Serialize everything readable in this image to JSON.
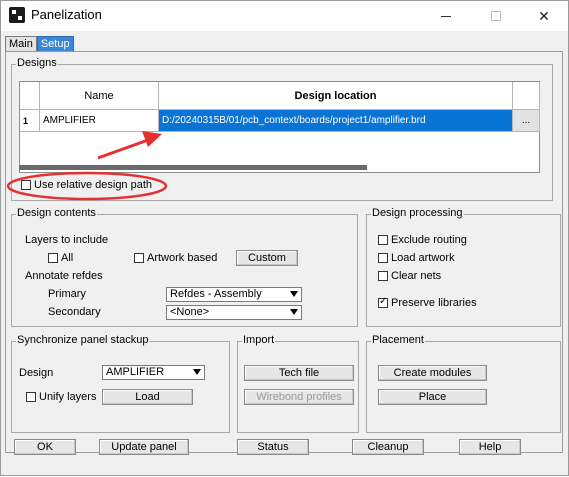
{
  "window": {
    "title": "Panelization"
  },
  "tabs": [
    {
      "label": "Main"
    },
    {
      "label": "Setup"
    }
  ],
  "designs": {
    "title": "Designs",
    "headers": {
      "index": "",
      "name": "Name",
      "location": "Design location",
      "extra": ""
    },
    "rows": [
      {
        "index": "1",
        "name": "AMPLIFIER",
        "location": "D:/20240315B/01/pcb_context/boards/project1/amplifier.brd",
        "extra": "..."
      }
    ],
    "relative_path_label": "Use relative design path",
    "relative_path_checked": false
  },
  "design_contents": {
    "title": "Design contents",
    "layers_label": "Layers to include",
    "all_label": "All",
    "all_checked": false,
    "artwork_label": "Artwork based",
    "artwork_checked": false,
    "custom_button": "Custom",
    "annotate_label": "Annotate refdes",
    "primary_label": "Primary",
    "primary_value": "Refdes - Assembly",
    "secondary_label": "Secondary",
    "secondary_value": "<None>"
  },
  "design_processing": {
    "title": "Design processing",
    "options": [
      {
        "label": "Exclude routing",
        "checked": false
      },
      {
        "label": "Load artwork",
        "checked": false
      },
      {
        "label": "Clear nets",
        "checked": false
      },
      {
        "label": "Preserve libraries",
        "checked": true
      }
    ]
  },
  "sync": {
    "title": "Synchronize panel stackup",
    "design_label": "Design",
    "design_value": "AMPLIFIER",
    "unify_label": "Unify layers",
    "unify_checked": false,
    "load_button": "Load"
  },
  "import": {
    "title": "Import",
    "tech_button": "Tech file",
    "wirebond_button": "Wirebond profiles"
  },
  "placement": {
    "title": "Placement",
    "create_button": "Create modules",
    "place_button": "Place"
  },
  "footer": {
    "ok": "OK",
    "update": "Update panel",
    "status": "Status",
    "cleanup": "Cleanup",
    "help": "Help"
  },
  "colors": {
    "accent": "#0a74d4",
    "annotation": "#e53030"
  }
}
